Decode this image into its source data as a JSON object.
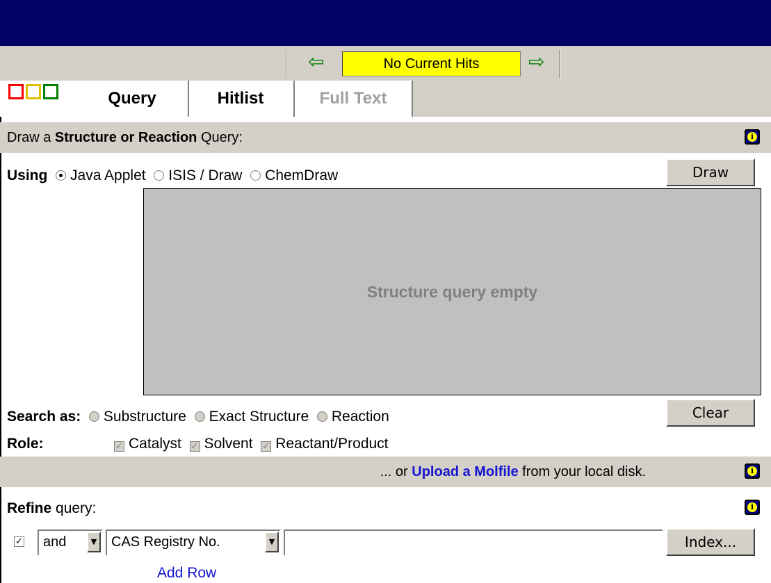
{
  "toolbar": {
    "hits_label": "No Current Hits",
    "prev_icon": "left-arrow-icon",
    "next_icon": "right-arrow-icon",
    "prev_glyph": "⇦",
    "next_glyph": "⇨",
    "hits_color": "#ffff00",
    "arrow_color": "#008000"
  },
  "header": {
    "bar_color": "#000066"
  },
  "tabs": [
    {
      "label": "Query",
      "active": true
    },
    {
      "label": "Hitlist",
      "active": false
    },
    {
      "label": "Full Text",
      "active": false,
      "disabled": true
    }
  ],
  "structure_section": {
    "prefix": "Draw a ",
    "bold": "Structure or Reaction",
    "suffix": " Query:"
  },
  "using": {
    "label": "Using",
    "options": [
      {
        "label": "Java Applet",
        "checked": true
      },
      {
        "label": "ISIS / Draw",
        "checked": false
      },
      {
        "label": "ChemDraw",
        "checked": false
      }
    ],
    "draw_button": "Draw"
  },
  "canvas": {
    "empty_text": "Structure query empty"
  },
  "search_as": {
    "label": "Search as:",
    "options": [
      "Substructure",
      "Exact Structure",
      "Reaction"
    ],
    "clear_button": "Clear"
  },
  "role": {
    "label": "Role:",
    "options": [
      "Catalyst",
      "Solvent",
      "Reactant/Product"
    ]
  },
  "upload": {
    "prefix": "... or ",
    "link": "Upload a Molfile",
    "suffix": " from your local disk."
  },
  "refine": {
    "bold": "Refine",
    "suffix": " query:",
    "operator": "and",
    "field": "CAS Registry No.",
    "value": "",
    "index_button": "Index...",
    "add_row": "Add Row"
  }
}
